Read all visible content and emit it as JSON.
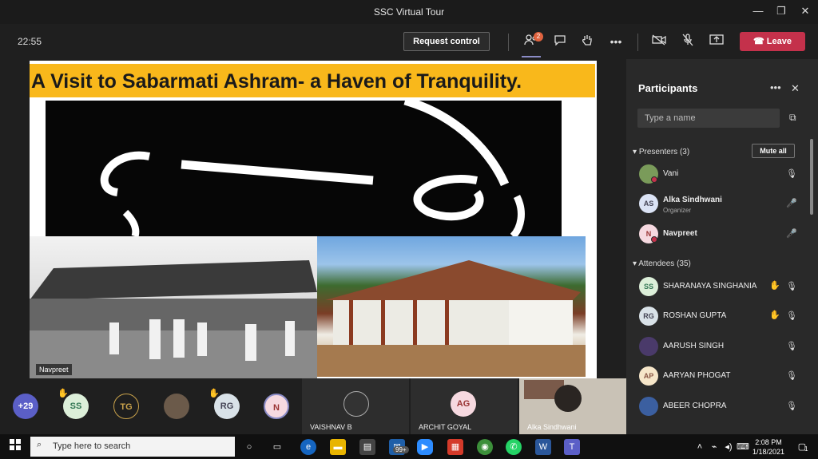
{
  "window": {
    "title": "SSC Virtual Tour",
    "min": "—",
    "max": "❐",
    "close": "✕"
  },
  "toolbar": {
    "timer": "22:55",
    "request_control": "Request control",
    "participants_badge": "2",
    "leave": "Leave",
    "icons": [
      "people-icon",
      "chat-icon",
      "raise-hand-icon",
      "more-icon",
      "camera-off-icon",
      "mic-off-icon",
      "share-icon",
      "phone-icon"
    ]
  },
  "slide": {
    "title": "A Visit to Sabarmati Ashram- a Haven of Tranquility.",
    "presenter_name": "Navpreet"
  },
  "panel": {
    "title": "Participants",
    "more": "•••",
    "close": "✕",
    "search_placeholder": "Type a name",
    "presenters_label": "Presenters (3)",
    "mute_all": "Mute all",
    "attendees_label": "Attendees (35)",
    "presenters": [
      {
        "name": "Vani",
        "initials": "",
        "role": "",
        "color": "#7a9b5a",
        "mic": "muted"
      },
      {
        "name": "Alka Sindhwani",
        "initials": "AS",
        "role": "Organizer",
        "color": "#dbe3f5",
        "mic": "on"
      },
      {
        "name": "Navpreet",
        "initials": "N",
        "role": "",
        "color": "#f6d9e0",
        "mic": "on"
      }
    ],
    "attendees": [
      {
        "name": "SHARANAYA SINGHANIA",
        "initials": "SS",
        "color": "#dcefd9",
        "hand": true
      },
      {
        "name": "ROSHAN GUPTA",
        "initials": "RG",
        "color": "#d9e2e8",
        "hand": true
      },
      {
        "name": "AARUSH SINGH",
        "initials": "",
        "color": "#4a3a6a",
        "hand": false
      },
      {
        "name": "AARYAN PHOGAT",
        "initials": "AP",
        "color": "#f6e6c9",
        "hand": false
      },
      {
        "name": "ABEER CHOPRA",
        "initials": "",
        "color": "#3b5fa0",
        "hand": false
      }
    ]
  },
  "strip": {
    "more_count": "+29",
    "avatars": [
      {
        "initials": "SS",
        "color": "#dcefd9",
        "hand": true
      },
      {
        "initials": "TG",
        "color": "#1e1e1e",
        "hand": false
      },
      {
        "initials": "",
        "color": "#6b5a4a",
        "hand": false
      },
      {
        "initials": "RG",
        "color": "#d9e2e8",
        "hand": true
      },
      {
        "initials": "N",
        "color": "#f6d9e0",
        "hand": false
      }
    ],
    "tiles": [
      {
        "name": "VAISHNAV B"
      },
      {
        "name": "ARCHIT GOYAL",
        "initials": "AG"
      },
      {
        "name": "Alka Sindhwani"
      }
    ]
  },
  "taskbar": {
    "search_placeholder": "Type here to search",
    "badge": "99+",
    "time": "2:08 PM",
    "date": "1/18/2021",
    "notifications": "1"
  }
}
